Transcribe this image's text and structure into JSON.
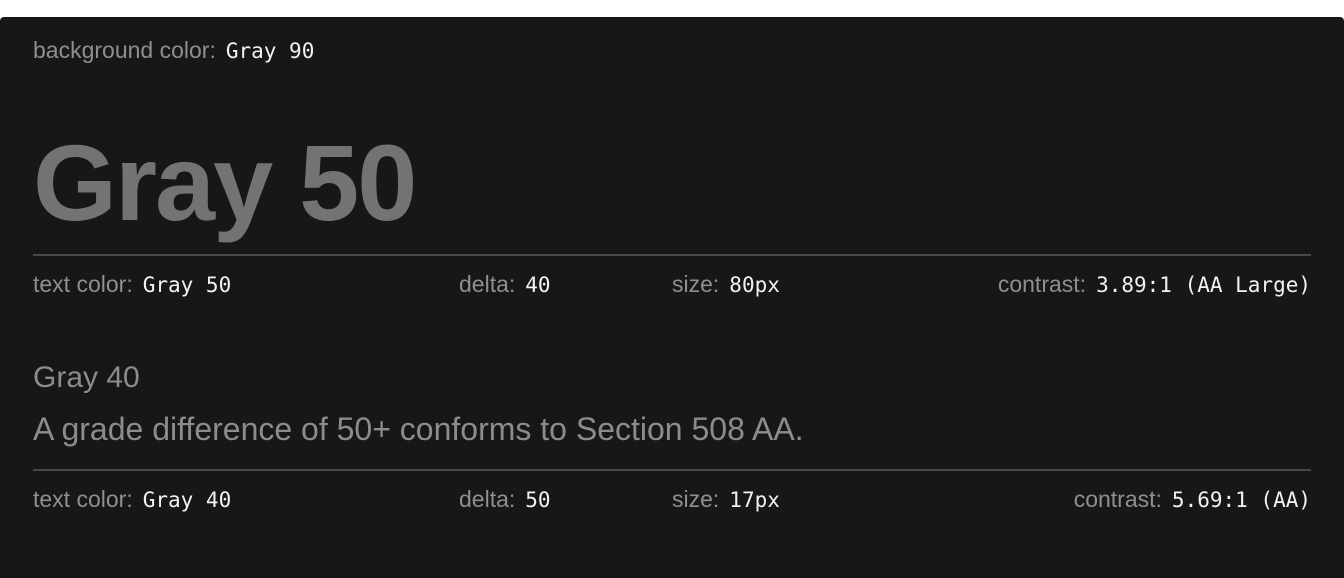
{
  "background": {
    "label": "background color:",
    "value": "Gray 90",
    "color": "#171717"
  },
  "large_sample": {
    "text": "Gray 50",
    "color": "#737373",
    "meta": {
      "text_color_label": "text color:",
      "text_color_value": "Gray 50",
      "delta_label": "delta:",
      "delta_value": "40",
      "size_label": "size:",
      "size_value": "80px",
      "contrast_label": "contrast:",
      "contrast_value": "3.89:1 (AA Large)"
    }
  },
  "small_sample": {
    "title": "Gray 40",
    "body": "A grade difference of 50+ conforms to Section 508 AA.",
    "color": "#8c8c8c",
    "meta": {
      "text_color_label": "text color:",
      "text_color_value": "Gray 40",
      "delta_label": "delta:",
      "delta_value": "50",
      "size_label": "size:",
      "size_value": "17px",
      "contrast_label": "contrast:",
      "contrast_value": "5.69:1 (AA)"
    }
  }
}
